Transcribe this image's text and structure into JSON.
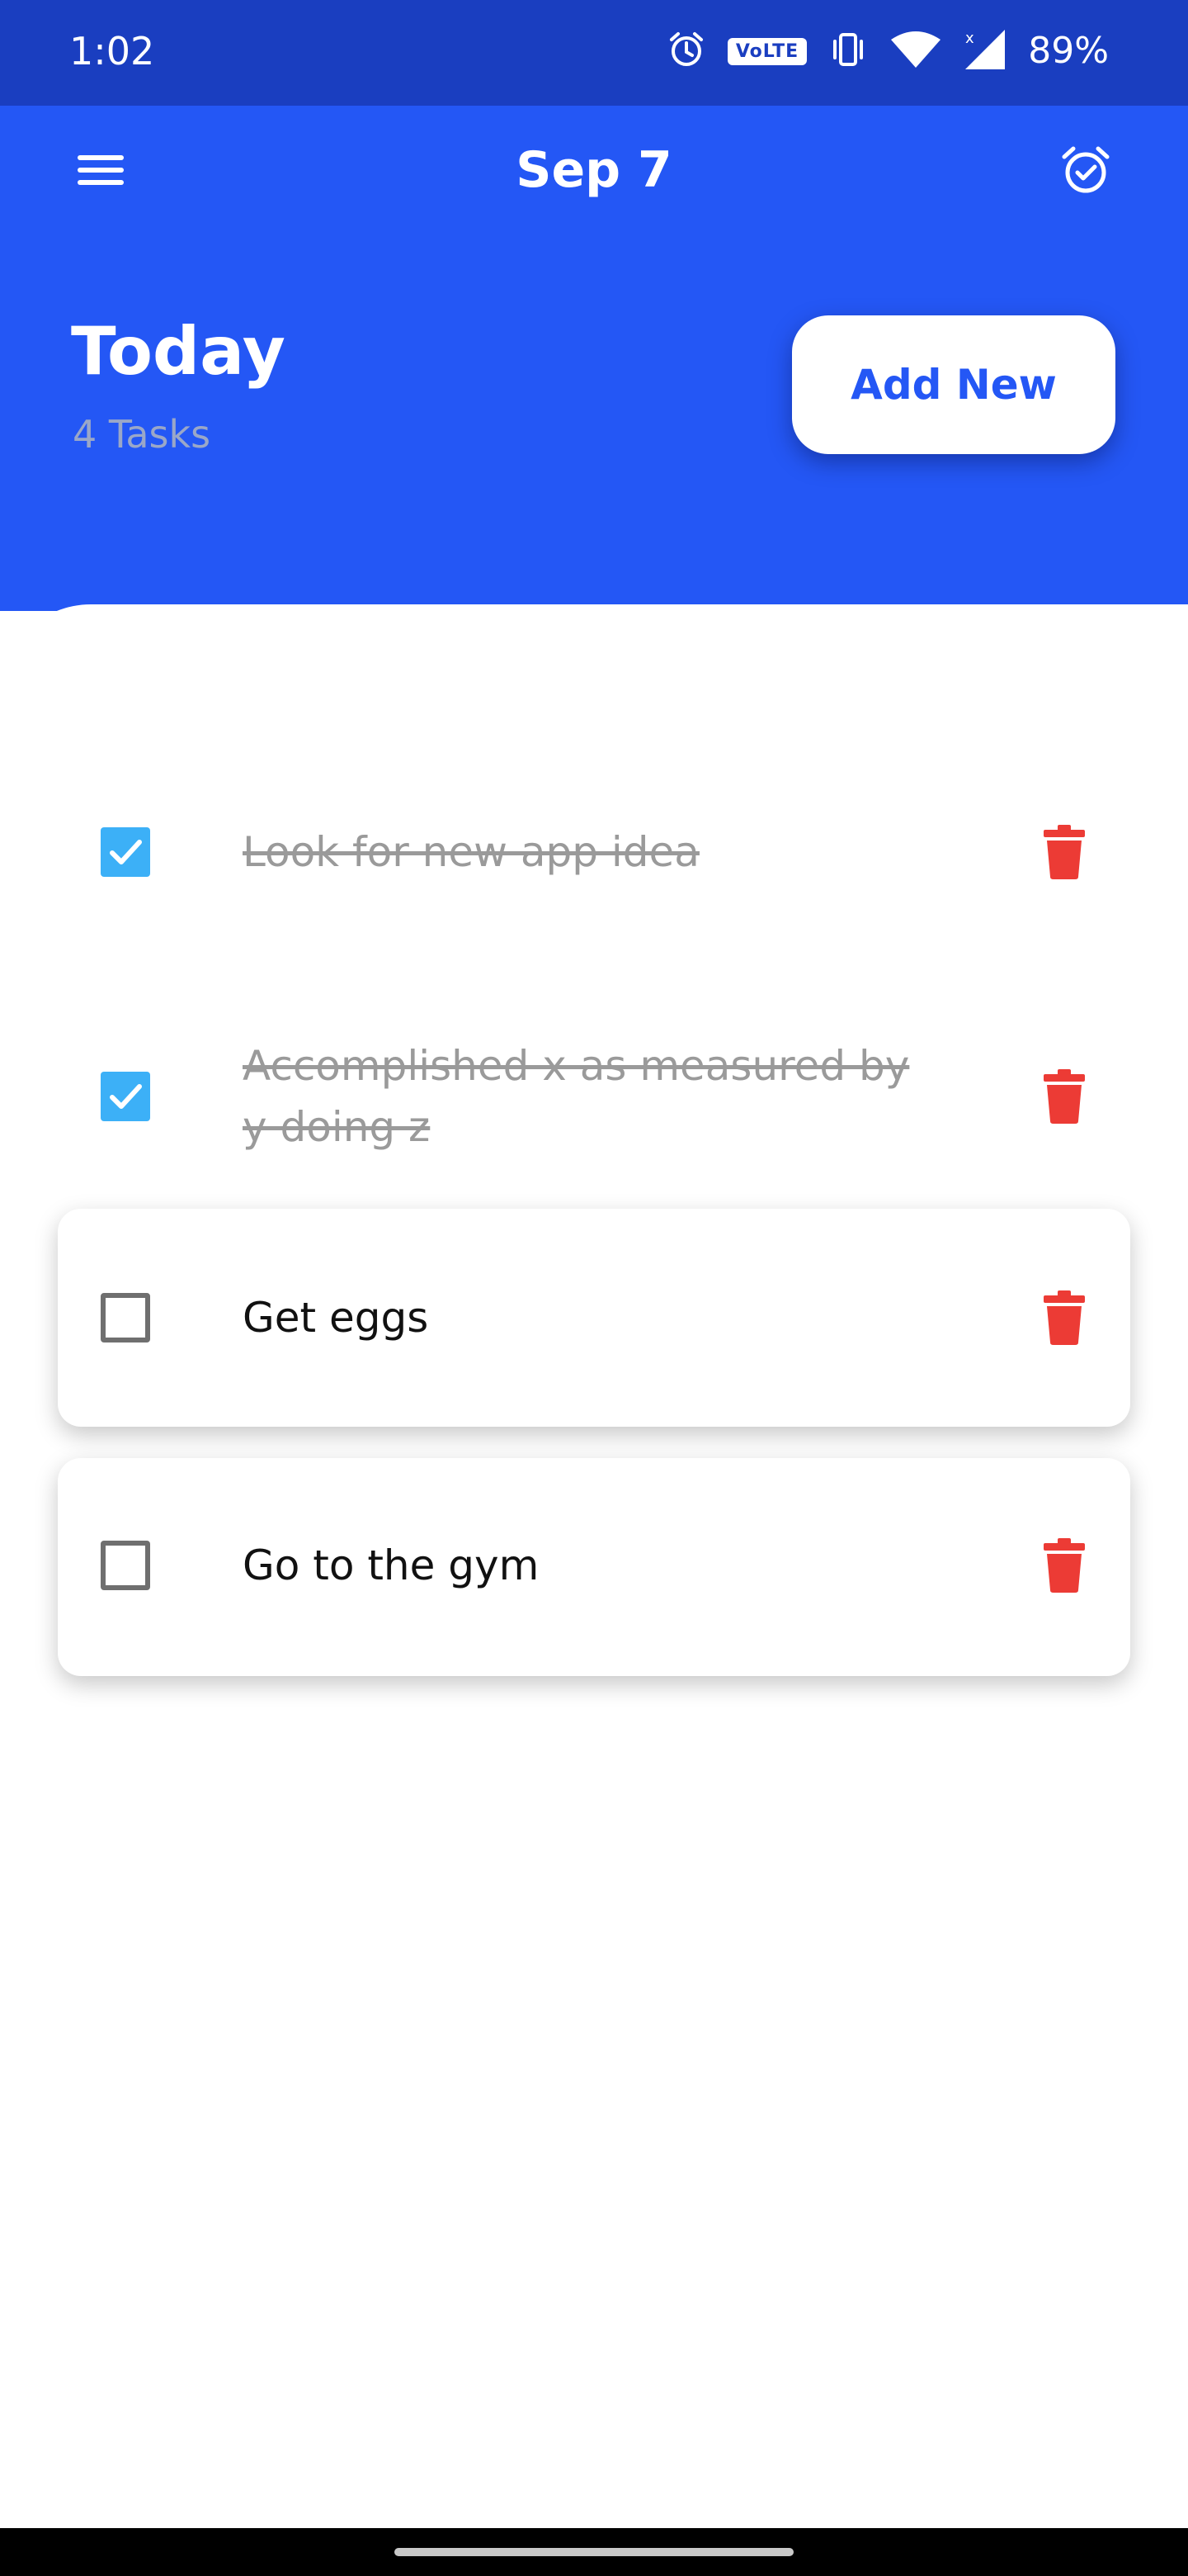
{
  "status_bar": {
    "time": "1:02",
    "volte": "VoLTE",
    "battery": "89%",
    "icons": [
      "alarm-icon",
      "volte-icon",
      "vibrate-icon",
      "wifi-icon",
      "signal-icon"
    ]
  },
  "header": {
    "title": "Sep 7",
    "menu_icon": "hamburger-menu-icon",
    "alarm_icon": "alarm-check-icon",
    "today_label": "Today",
    "task_count": "4 Tasks",
    "add_button": "Add New"
  },
  "tasks": [
    {
      "text": "Look for new app idea",
      "done": true
    },
    {
      "text": "Accomplished x as measured by y doing z",
      "done": true
    },
    {
      "text": "Get eggs",
      "done": false
    },
    {
      "text": "Go to the gym",
      "done": false
    }
  ],
  "colors": {
    "status_bar": "#1a3ec0",
    "header": "#2457f5",
    "checkbox_checked": "#3cb0f7",
    "delete_icon": "#ec3b35",
    "done_text": "#9a9a9a"
  }
}
